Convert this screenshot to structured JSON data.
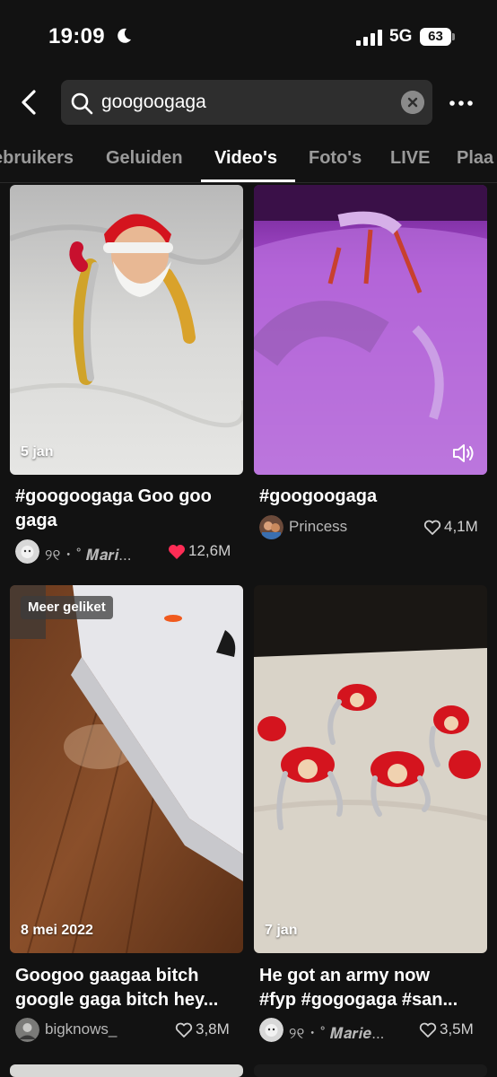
{
  "status": {
    "time": "19:09",
    "network": "5G",
    "battery": "63"
  },
  "search": {
    "query": "googoogaga"
  },
  "tabs": [
    {
      "label": "ebruikers"
    },
    {
      "label": "Geluiden"
    },
    {
      "label": "Video's"
    },
    {
      "label": "Foto's"
    },
    {
      "label": "LIVE"
    },
    {
      "label": "Plaa"
    }
  ],
  "videos": [
    {
      "date": "5 jan",
      "caption_l1": "#googoogaga Goo goo",
      "caption_l2": "gaga",
      "author": "୨୧ ･ ˚ 𝑴𝒂𝒓𝒊...",
      "likes": "12,6M",
      "liked": true
    },
    {
      "date": "",
      "caption_l1": "#googoogaga",
      "caption_l2": "",
      "author": "Princess",
      "likes": "4,1M",
      "liked": false
    },
    {
      "badge": "Meer geliket",
      "date": "8 mei 2022",
      "caption_l1": "Googoo gaagaa bitch",
      "caption_l2": "google gaga bitch hey...",
      "author": "bigknows_",
      "likes": "3,8M",
      "liked": false
    },
    {
      "date": "7 jan",
      "caption_l1": "He got an army now",
      "caption_l2": "#fyp #gogogaga #san...",
      "author": "୨୧ ･ ˚ 𝑴𝒂𝒓𝒊𝒆...",
      "likes": "3,5M",
      "liked": false
    }
  ],
  "colors": {
    "background": "#121212",
    "liked_heart": "#fe2c55",
    "search_box": "#2e2e2e"
  }
}
